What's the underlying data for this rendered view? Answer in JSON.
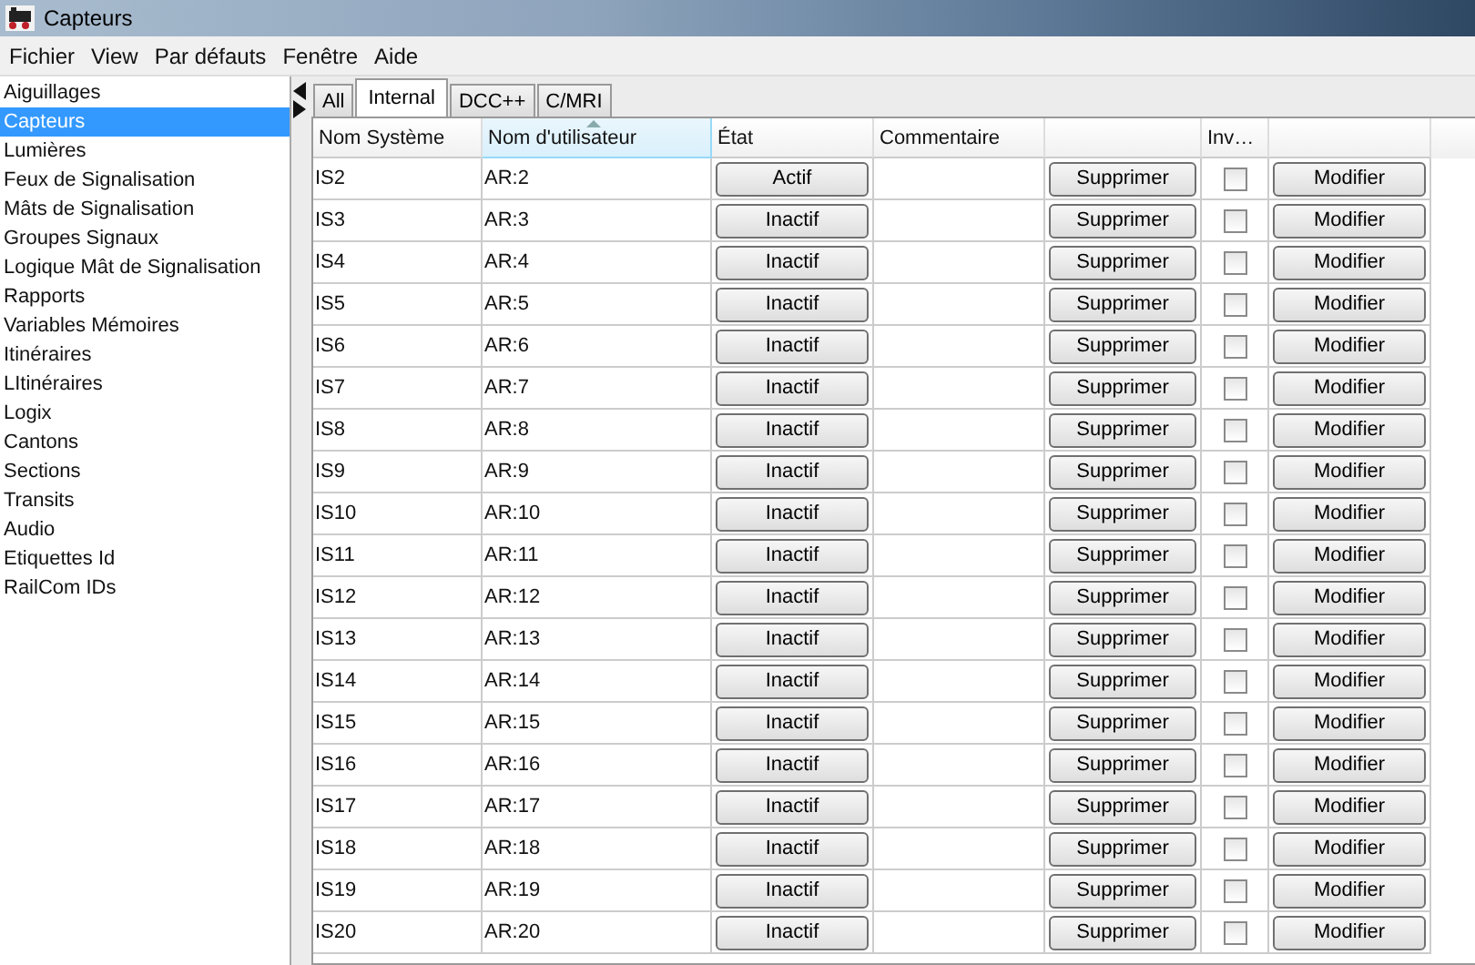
{
  "window": {
    "title": "Capteurs"
  },
  "menu": [
    "Fichier",
    "View",
    "Par défauts",
    "Fenêtre",
    "Aide"
  ],
  "sidebar": {
    "items": [
      {
        "label": "Aiguillages",
        "selected": false
      },
      {
        "label": "Capteurs",
        "selected": true
      },
      {
        "label": "Lumières",
        "selected": false
      },
      {
        "label": "Feux de Signalisation",
        "selected": false
      },
      {
        "label": "Mâts de Signalisation",
        "selected": false
      },
      {
        "label": "Groupes Signaux",
        "selected": false
      },
      {
        "label": "Logique Mât de Signalisation",
        "selected": false
      },
      {
        "label": "Rapports",
        "selected": false
      },
      {
        "label": "Variables Mémoires",
        "selected": false
      },
      {
        "label": "Itinéraires",
        "selected": false
      },
      {
        "label": "LItinéraires",
        "selected": false
      },
      {
        "label": "Logix",
        "selected": false
      },
      {
        "label": "Cantons",
        "selected": false
      },
      {
        "label": "Sections",
        "selected": false
      },
      {
        "label": "Transits",
        "selected": false
      },
      {
        "label": "Audio",
        "selected": false
      },
      {
        "label": "Etiquettes Id",
        "selected": false
      },
      {
        "label": "RailCom IDs",
        "selected": false
      }
    ]
  },
  "tabs": [
    {
      "label": "All",
      "selected": false
    },
    {
      "label": "Internal",
      "selected": true
    },
    {
      "label": "DCC++",
      "selected": false
    },
    {
      "label": "C/MRI",
      "selected": false
    }
  ],
  "table": {
    "columns": [
      {
        "label": "Nom Système",
        "sorted": false
      },
      {
        "label": "Nom d'utilisateur",
        "sorted": true
      },
      {
        "label": "État",
        "sorted": false
      },
      {
        "label": "Commentaire",
        "sorted": false
      },
      {
        "sorted": false
      },
      {
        "label": "Inv…",
        "sorted": false
      },
      {
        "sorted": false
      }
    ],
    "rows": [
      {
        "system": "IS2",
        "user": "AR:2",
        "state": "Actif",
        "delete": "Supprimer",
        "inverted": false,
        "edit": "Modifier"
      },
      {
        "system": "IS3",
        "user": "AR:3",
        "state": "Inactif",
        "delete": "Supprimer",
        "inverted": false,
        "edit": "Modifier"
      },
      {
        "system": "IS4",
        "user": "AR:4",
        "state": "Inactif",
        "delete": "Supprimer",
        "inverted": false,
        "edit": "Modifier"
      },
      {
        "system": "IS5",
        "user": "AR:5",
        "state": "Inactif",
        "delete": "Supprimer",
        "inverted": false,
        "edit": "Modifier"
      },
      {
        "system": "IS6",
        "user": "AR:6",
        "state": "Inactif",
        "delete": "Supprimer",
        "inverted": false,
        "edit": "Modifier"
      },
      {
        "system": "IS7",
        "user": "AR:7",
        "state": "Inactif",
        "delete": "Supprimer",
        "inverted": false,
        "edit": "Modifier"
      },
      {
        "system": "IS8",
        "user": "AR:8",
        "state": "Inactif",
        "delete": "Supprimer",
        "inverted": false,
        "edit": "Modifier"
      },
      {
        "system": "IS9",
        "user": "AR:9",
        "state": "Inactif",
        "delete": "Supprimer",
        "inverted": false,
        "edit": "Modifier"
      },
      {
        "system": "IS10",
        "user": "AR:10",
        "state": "Inactif",
        "delete": "Supprimer",
        "inverted": false,
        "edit": "Modifier"
      },
      {
        "system": "IS11",
        "user": "AR:11",
        "state": "Inactif",
        "delete": "Supprimer",
        "inverted": false,
        "edit": "Modifier"
      },
      {
        "system": "IS12",
        "user": "AR:12",
        "state": "Inactif",
        "delete": "Supprimer",
        "inverted": false,
        "edit": "Modifier"
      },
      {
        "system": "IS13",
        "user": "AR:13",
        "state": "Inactif",
        "delete": "Supprimer",
        "inverted": false,
        "edit": "Modifier"
      },
      {
        "system": "IS14",
        "user": "AR:14",
        "state": "Inactif",
        "delete": "Supprimer",
        "inverted": false,
        "edit": "Modifier"
      },
      {
        "system": "IS15",
        "user": "AR:15",
        "state": "Inactif",
        "delete": "Supprimer",
        "inverted": false,
        "edit": "Modifier"
      },
      {
        "system": "IS16",
        "user": "AR:16",
        "state": "Inactif",
        "delete": "Supprimer",
        "inverted": false,
        "edit": "Modifier"
      },
      {
        "system": "IS17",
        "user": "AR:17",
        "state": "Inactif",
        "delete": "Supprimer",
        "inverted": false,
        "edit": "Modifier"
      },
      {
        "system": "IS18",
        "user": "AR:18",
        "state": "Inactif",
        "delete": "Supprimer",
        "inverted": false,
        "edit": "Modifier"
      },
      {
        "system": "IS19",
        "user": "AR:19",
        "state": "Inactif",
        "delete": "Supprimer",
        "inverted": false,
        "edit": "Modifier"
      },
      {
        "system": "IS20",
        "user": "AR:20",
        "state": "Inactif",
        "delete": "Supprimer",
        "inverted": false,
        "edit": "Modifier"
      }
    ]
  }
}
